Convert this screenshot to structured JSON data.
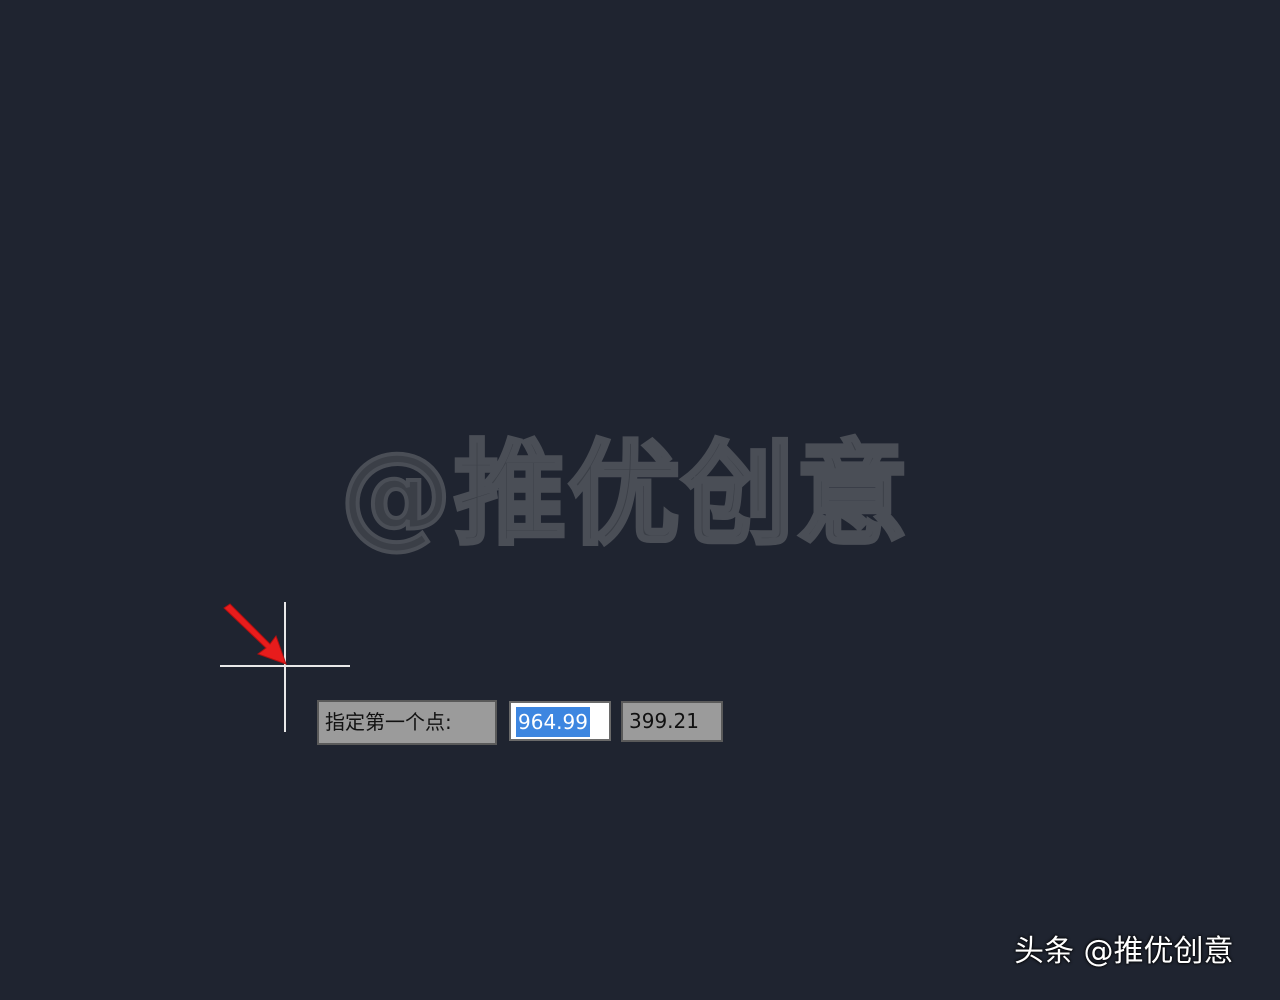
{
  "watermark": {
    "center_text": "@推优创意",
    "corner_text": "头条 @推优创意"
  },
  "dynamic_input": {
    "prompt": "指定第一个点:",
    "x_value": "964.99",
    "y_value": "399.21"
  },
  "icons": {
    "cursor": "crosshair-cursor-icon",
    "pointer": "red-arrow-icon"
  },
  "colors": {
    "background": "#1f2430",
    "selection": "#3d86e0",
    "arrow": "#e81c1c",
    "crosshair": "#e8e8e8"
  }
}
